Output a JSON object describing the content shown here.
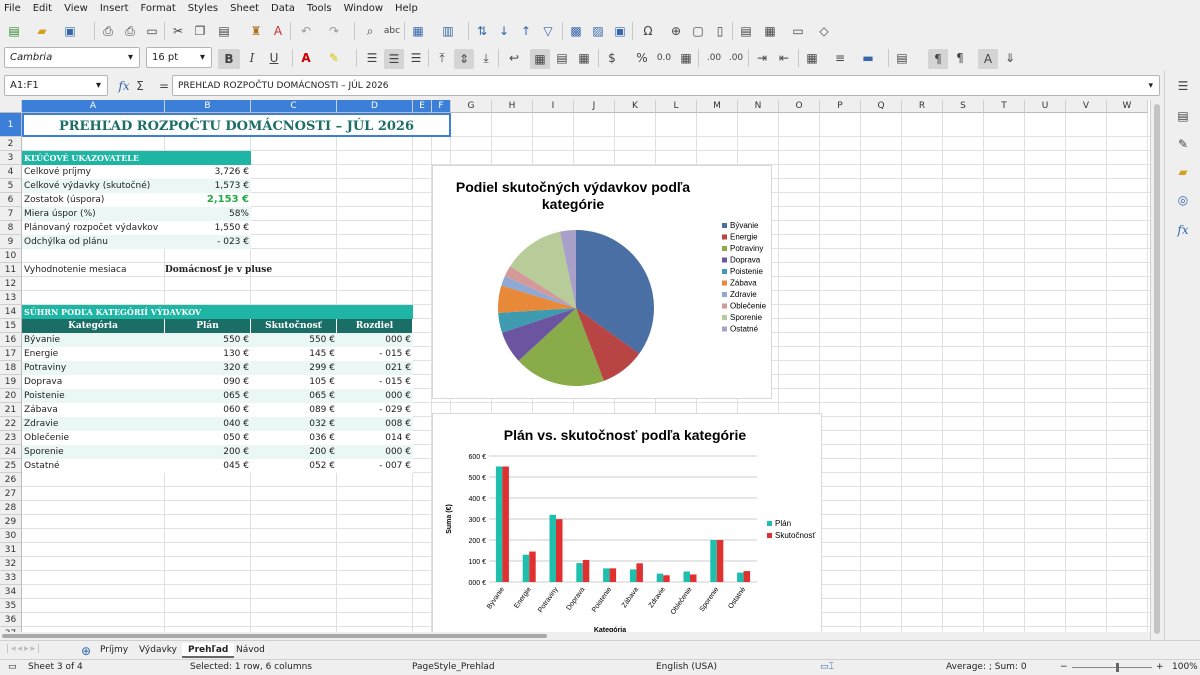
{
  "menu": [
    "File",
    "Edit",
    "View",
    "Insert",
    "Format",
    "Styles",
    "Sheet",
    "Data",
    "Tools",
    "Window",
    "Help"
  ],
  "toolbar": {
    "font_name": "Cambria",
    "font_size": "16 pt",
    "bold_label": "B",
    "italic_label": "I",
    "underline_label": "U",
    "percent_label": "%",
    "decimal_label": "0.0",
    "add_decimal_label": ".00",
    "del_decimal_label": ".00"
  },
  "formula_bar": {
    "name_box": "A1:F1",
    "fx_label": "fx",
    "sum_label": "Σ",
    "eq_label": "=",
    "content": "PREHĽAD ROZPOČTU DOMÁCNOSTI – JÚL 2026"
  },
  "columns": [
    "A",
    "B",
    "C",
    "D",
    "E",
    "F",
    "G",
    "H",
    "I",
    "J",
    "K",
    "L",
    "M",
    "N",
    "O",
    "P",
    "Q",
    "R",
    "S",
    "T",
    "U",
    "V",
    "W"
  ],
  "rows": [
    "1",
    "2",
    "3",
    "4",
    "5",
    "6",
    "7",
    "8",
    "9",
    "10",
    "11",
    "12",
    "13",
    "14",
    "15",
    "16",
    "17",
    "18",
    "19",
    "20",
    "21",
    "22",
    "23",
    "24",
    "25",
    "26",
    "27",
    "28",
    "29",
    "30",
    "31",
    "32",
    "33",
    "34",
    "35",
    "36",
    "37"
  ],
  "sheet": {
    "title": "PREHĽAD ROZPOČTU DOMÁCNOSTI – JÚL 2026",
    "kpi_header": "KĽÚČOVÉ UKAZOVATELE",
    "kpis": [
      {
        "label": "Celkové príjmy",
        "value": "3,726 €"
      },
      {
        "label": "Celkové výdavky (skutočné)",
        "value": "1,573 €"
      },
      {
        "label": "Zostatok (úspora)",
        "value": "2,153 €"
      },
      {
        "label": "Miera úspor (%)",
        "value": "58%"
      },
      {
        "label": "Plánovaný rozpočet výdavkov",
        "value": "1,550 €"
      },
      {
        "label": "Odchýlka od plánu",
        "value": "- 023 €"
      }
    ],
    "eval_label": "Vyhodnotenie mesiaca",
    "eval_value": "Domácnosť je v pluse",
    "summary_header": "SÚHRN PODĽA KATEGÓRIÍ VÝDAVKOV",
    "summary_cols": [
      "Kategória",
      "Plán",
      "Skutočnosť",
      "Rozdiel"
    ],
    "summary_rows": [
      {
        "cat": "Bývanie",
        "plan": "550 €",
        "actual": "550 €",
        "diff": "000 €"
      },
      {
        "cat": "Energie",
        "plan": "130 €",
        "actual": "145 €",
        "diff": "- 015 €"
      },
      {
        "cat": "Potraviny",
        "plan": "320 €",
        "actual": "299 €",
        "diff": "021 €"
      },
      {
        "cat": "Doprava",
        "plan": "090 €",
        "actual": "105 €",
        "diff": "- 015 €"
      },
      {
        "cat": "Poistenie",
        "plan": "065 €",
        "actual": "065 €",
        "diff": "000 €"
      },
      {
        "cat": "Zábava",
        "plan": "060 €",
        "actual": "089 €",
        "diff": "- 029 €"
      },
      {
        "cat": "Zdravie",
        "plan": "040 €",
        "actual": "032 €",
        "diff": "008 €"
      },
      {
        "cat": "Oblečenie",
        "plan": "050 €",
        "actual": "036 €",
        "diff": "014 €"
      },
      {
        "cat": "Sporenie",
        "plan": "200 €",
        "actual": "200 €",
        "diff": "000 €"
      },
      {
        "cat": "Ostatné",
        "plan": "045 €",
        "actual": "052 €",
        "diff": "- 007 €"
      }
    ]
  },
  "chart_data": [
    {
      "type": "pie",
      "title": "Podiel skutočných výdavkov podľa kategórie",
      "categories": [
        "Bývanie",
        "Energie",
        "Potraviny",
        "Doprava",
        "Poistenie",
        "Zábava",
        "Zdravie",
        "Oblečenie",
        "Sporenie",
        "Ostatné"
      ],
      "values": [
        550,
        145,
        299,
        105,
        65,
        89,
        32,
        36,
        200,
        52
      ],
      "colors": [
        "#4a6fa5",
        "#b84444",
        "#8aab49",
        "#6c55a0",
        "#3e9bb0",
        "#e8893a",
        "#8fa8d4",
        "#d49a9a",
        "#b8cc9a",
        "#a8a0c8"
      ],
      "legend": "right"
    },
    {
      "type": "bar",
      "title": "Plán vs. skutočnosť podľa kategórie",
      "categories": [
        "Bývanie",
        "Energie",
        "Potraviny",
        "Doprava",
        "Poistenie",
        "Zábava",
        "Zdravie",
        "Oblečenie",
        "Sporenie",
        "Ostatné"
      ],
      "series": [
        {
          "name": "Plán",
          "values": [
            550,
            130,
            320,
            90,
            65,
            60,
            40,
            50,
            200,
            45
          ],
          "color": "#1fbfb0"
        },
        {
          "name": "Skutočnosť",
          "values": [
            550,
            145,
            299,
            105,
            65,
            89,
            32,
            36,
            200,
            52
          ],
          "color": "#e03030"
        }
      ],
      "xlabel": "Kategória",
      "ylabel": "Suma (€)",
      "ylim": [
        0,
        600
      ],
      "yticks": [
        "000 €",
        "100 €",
        "200 €",
        "300 €",
        "400 €",
        "500 €",
        "600 €"
      ],
      "legend": "right"
    }
  ],
  "tabs": [
    "Príjmy",
    "Výdavky",
    "Prehľad",
    "Návod"
  ],
  "active_tab": "Prehľad",
  "status": {
    "sheet": "Sheet 3 of 4",
    "selection": "Selected: 1 row, 6 columns",
    "page_style": "PageStyle_Prehlad",
    "language": "English (USA)",
    "summary": "Average: ; Sum: 0",
    "zoom": "100%"
  }
}
